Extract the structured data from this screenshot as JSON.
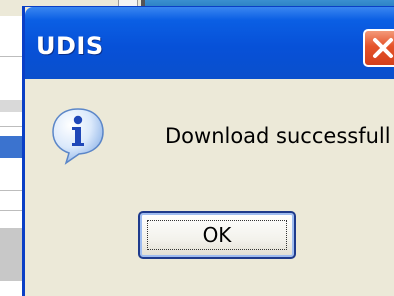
{
  "dialog": {
    "title": "UDIS",
    "message": "Download successfull",
    "ok_label": "OK",
    "icons": {
      "info": "info-icon",
      "close": "close-icon"
    }
  },
  "colors": {
    "titlebar": "#0751d8",
    "dialog_bg": "#ece9d8",
    "close_button": "#e5532a"
  }
}
